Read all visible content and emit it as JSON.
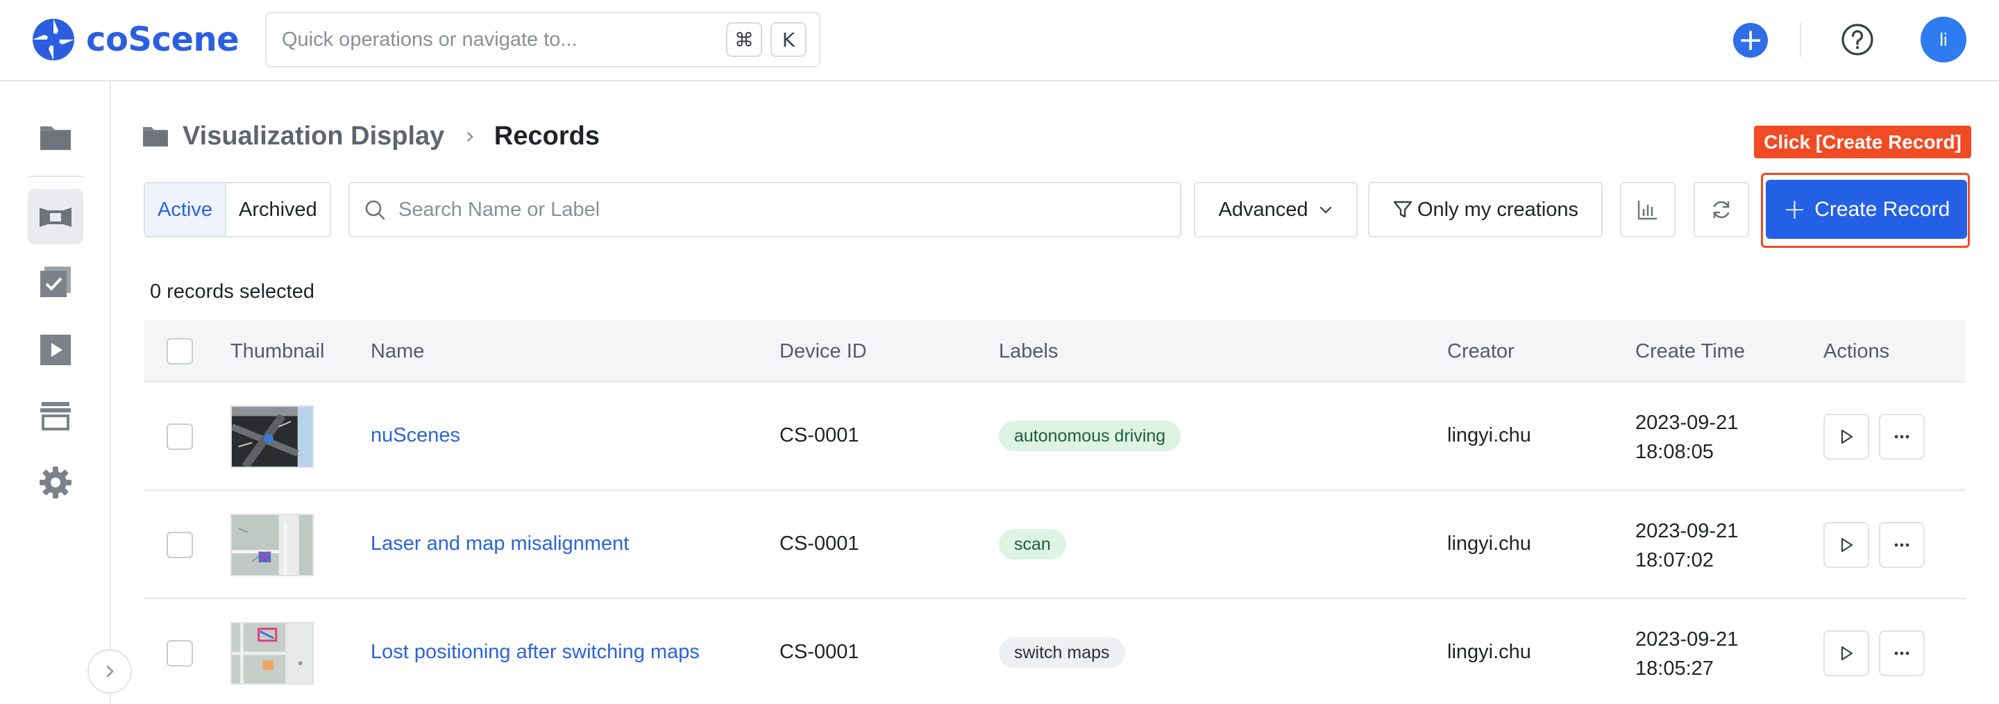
{
  "app": {
    "logo_text": "coScene",
    "brand_color": "#2b5fe0"
  },
  "header": {
    "quick_search_placeholder": "Quick operations or navigate to...",
    "shortcut_key_1": "⌘",
    "shortcut_key_2": "K",
    "add_icon": "plus-circle-icon",
    "help_icon": "question-circle-icon",
    "avatar_initials": "li"
  },
  "sidebar": {
    "items": [
      {
        "icon": "folder-icon",
        "active": false
      },
      {
        "icon": "records-icon",
        "active": true
      },
      {
        "icon": "tasks-check-icon",
        "active": false
      },
      {
        "icon": "play-icon",
        "active": false
      },
      {
        "icon": "archive-icon",
        "active": false
      },
      {
        "icon": "gear-icon",
        "active": false
      }
    ],
    "collapse_icon": "chevron-right-icon"
  },
  "breadcrumb": {
    "project": "Visualization Display",
    "current": "Records"
  },
  "annotation": {
    "tooltip": "Click [Create Record]",
    "color": "#f04b24"
  },
  "toolbar": {
    "tab_active": "Active",
    "tab_archived": "Archived",
    "search_placeholder": "Search Name or Label",
    "advanced_label": "Advanced",
    "only_mine_label": "Only my creations",
    "create_label": "Create Record",
    "accent_color": "#2561e6"
  },
  "selection": {
    "text": "0 records selected"
  },
  "table": {
    "columns": [
      "Thumbnail",
      "Name",
      "Device ID",
      "Labels",
      "Creator",
      "Create Time",
      "Actions"
    ],
    "rows": [
      {
        "name": "nuScenes",
        "device_id": "CS-0001",
        "label": "autonomous driving",
        "label_style": "green",
        "creator": "lingyi.chu",
        "date": "2023-09-21",
        "time": "18:08:05"
      },
      {
        "name": "Laser and map misalignment",
        "device_id": "CS-0001",
        "label": "scan",
        "label_style": "green",
        "creator": "lingyi.chu",
        "date": "2023-09-21",
        "time": "18:07:02"
      },
      {
        "name": "Lost positioning after switching maps",
        "device_id": "CS-0001",
        "label": "switch maps",
        "label_style": "gray",
        "creator": "lingyi.chu",
        "date": "2023-09-21",
        "time": "18:05:27"
      }
    ]
  }
}
